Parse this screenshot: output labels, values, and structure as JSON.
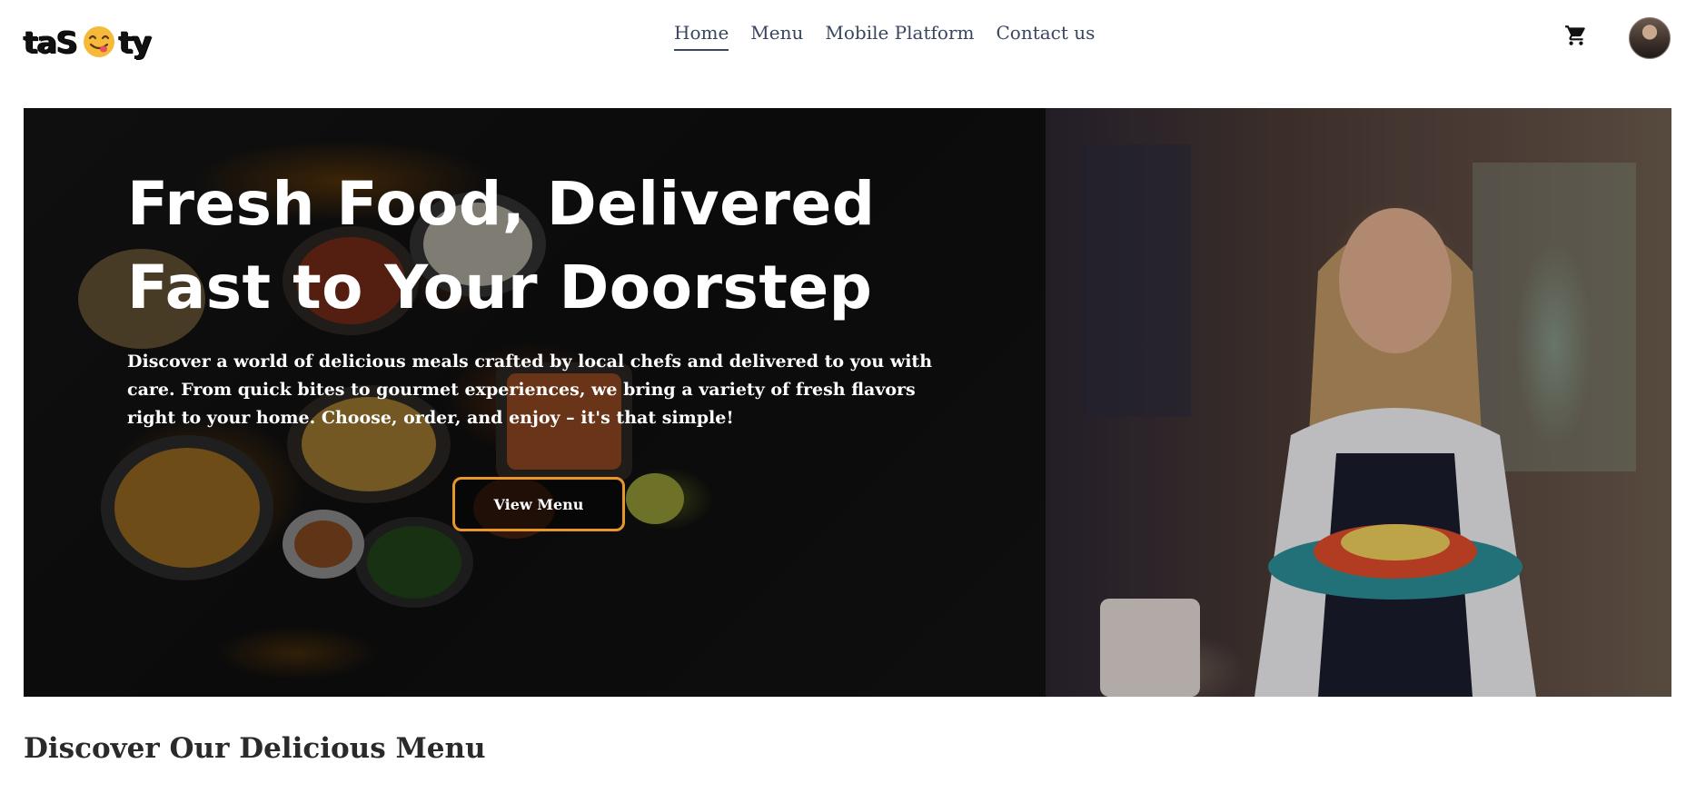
{
  "header": {
    "logo": {
      "text_before": "taS",
      "text_after": "ty",
      "face_icon": "face-savoring-food-icon"
    },
    "nav": [
      {
        "label": "Home",
        "active": true
      },
      {
        "label": "Menu",
        "active": false
      },
      {
        "label": "Mobile Platform",
        "active": false
      },
      {
        "label": "Contact us",
        "active": false
      }
    ],
    "cart_icon": "shopping-cart-icon",
    "avatar_icon": "user-avatar"
  },
  "hero": {
    "title_line1": "Fresh Food, Delivered",
    "title_line2": "Fast to Your Doorstep",
    "description": "Discover a world of delicious meals crafted by local chefs and delivered to you with care. From quick bites to gourmet experiences, we bring a variety of fresh flavors right to your home. Choose, order, and enjoy – it's that simple!",
    "button_label": "View Menu",
    "accent_color": "#e8962a"
  },
  "section": {
    "title": "Discover Our Delicious Menu"
  },
  "colors": {
    "nav_text": "#3a4560",
    "heading_text": "#2a2a2a",
    "hero_text": "#ffffff"
  }
}
